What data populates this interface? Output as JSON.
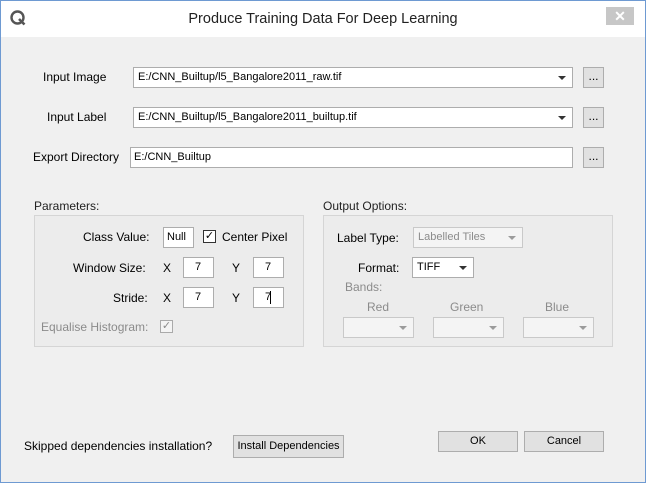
{
  "window": {
    "title": "Produce Training Data For Deep Learning",
    "close_glyph": "✕"
  },
  "input_image": {
    "label": "Input Image",
    "value": "E:/CNN_Builtup/l5_Bangalore2011_raw.tif",
    "browse": "..."
  },
  "input_label": {
    "label": "Input Label",
    "value": "E:/CNN_Builtup/l5_Bangalore2011_builtup.tif",
    "browse": "..."
  },
  "export_dir": {
    "label": "Export Directory",
    "value": "E:/CNN_Builtup",
    "browse": "..."
  },
  "parameters": {
    "title": "Parameters:",
    "class_value_label": "Class Value:",
    "class_value": "Null",
    "center_pixel_label": "Center Pixel",
    "center_pixel_checked": "✓",
    "window_size_label": "Window Size:",
    "window_x_label": "X",
    "window_x": "7",
    "window_y_label": "Y",
    "window_y": "7",
    "stride_label": "Stride:",
    "stride_x_label": "X",
    "stride_x": "7",
    "stride_y_label": "Y",
    "stride_y": "7",
    "equalise_label": "Equalise Histogram:",
    "equalise_checked": "✓"
  },
  "output_options": {
    "title": "Output Options:",
    "label_type_label": "Label Type:",
    "label_type_value": "Labelled Tiles",
    "format_label": "Format:",
    "format_value": "TIFF",
    "bands_label": "Bands:",
    "red_label": "Red",
    "green_label": "Green",
    "blue_label": "Blue"
  },
  "footer": {
    "skipped_text": "Skipped dependencies installation?",
    "install_button": "Install Dependencies",
    "ok_button": "OK",
    "cancel_button": "Cancel"
  },
  "colors": {
    "accent_border": "#6e9ad2",
    "dialog_bg": "#f0f0f0",
    "disabled_text": "#8b8b8b"
  }
}
